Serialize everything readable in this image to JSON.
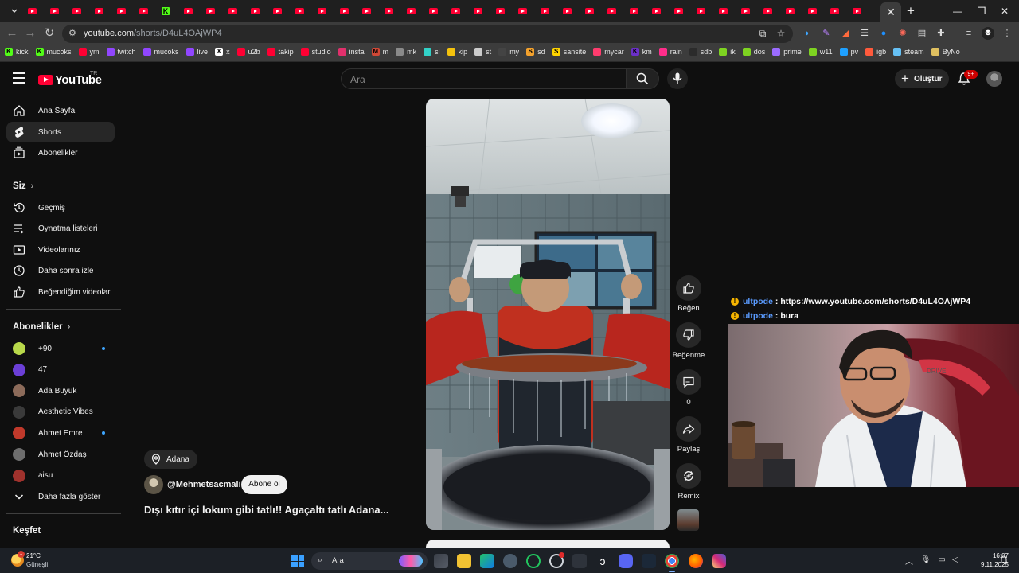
{
  "browser": {
    "tab_count_youtube": 38,
    "url_host": "youtube.com",
    "url_path": "/shorts/D4uL4OAjWP4",
    "bookmarks": [
      {
        "label": "kick",
        "icon": "kick-icon",
        "color": "#53fc18",
        "glyph": "K"
      },
      {
        "label": "mucoks",
        "icon": "kick-icon",
        "color": "#53fc18",
        "glyph": "K"
      },
      {
        "label": "ym",
        "icon": "youtube-music-icon",
        "color": "#ff0033",
        "glyph": ""
      },
      {
        "label": "twitch",
        "icon": "twitch-icon",
        "color": "#9146ff",
        "glyph": ""
      },
      {
        "label": "mucoks",
        "icon": "twitch-icon",
        "color": "#9146ff",
        "glyph": ""
      },
      {
        "label": "live",
        "icon": "twitch-icon",
        "color": "#9146ff",
        "glyph": ""
      },
      {
        "label": "x",
        "icon": "x-icon",
        "color": "#ffffff",
        "glyph": "X"
      },
      {
        "label": "u2b",
        "icon": "youtube-icon",
        "color": "#ff0033",
        "glyph": ""
      },
      {
        "label": "takip",
        "icon": "youtube-icon",
        "color": "#ff0033",
        "glyph": ""
      },
      {
        "label": "studio",
        "icon": "youtube-studio-icon",
        "color": "#ff0033",
        "glyph": ""
      },
      {
        "label": "insta",
        "icon": "instagram-icon",
        "color": "#e1306c",
        "glyph": ""
      },
      {
        "label": "m",
        "icon": "m-icon",
        "color": "#d14836",
        "glyph": "M"
      },
      {
        "label": "mk",
        "icon": "mk-icon",
        "color": "#8a8a8a",
        "glyph": ""
      },
      {
        "label": "sl",
        "icon": "sl-icon",
        "color": "#32d2c8",
        "glyph": ""
      },
      {
        "label": "kip",
        "icon": "kip-icon",
        "color": "#f4c20d",
        "glyph": ""
      },
      {
        "label": "st",
        "icon": "github-icon",
        "color": "#cccccc",
        "glyph": ""
      },
      {
        "label": "my",
        "icon": "my-icon",
        "color": "#444444",
        "glyph": ""
      },
      {
        "label": "sd",
        "icon": "sd-icon",
        "color": "#f4a22d",
        "glyph": "S"
      },
      {
        "label": "sansite",
        "icon": "s-icon",
        "color": "#ffd400",
        "glyph": "S"
      },
      {
        "label": "mycar",
        "icon": "mycar-icon",
        "color": "#ff3c6e",
        "glyph": ""
      },
      {
        "label": "km",
        "icon": "km-icon",
        "color": "#6b2fc9",
        "glyph": "K"
      },
      {
        "label": "rain",
        "icon": "rain-icon",
        "color": "#ff2d8a",
        "glyph": ""
      },
      {
        "label": "sdb",
        "icon": "sdb-icon",
        "color": "#2b2b2b",
        "glyph": ""
      },
      {
        "label": "ik",
        "icon": "power-icon",
        "color": "#7ed321",
        "glyph": ""
      },
      {
        "label": "dos",
        "icon": "power-icon",
        "color": "#7ed321",
        "glyph": ""
      },
      {
        "label": "prime",
        "icon": "prime-icon",
        "color": "#9b6bff",
        "glyph": ""
      },
      {
        "label": "w11",
        "icon": "power-icon",
        "color": "#7ed321",
        "glyph": ""
      },
      {
        "label": "pv",
        "icon": "pv-icon",
        "color": "#1ea0ff",
        "glyph": ""
      },
      {
        "label": "igb",
        "icon": "igb-icon",
        "color": "#ff5a3c",
        "glyph": ""
      },
      {
        "label": "steam",
        "icon": "steam-icon",
        "color": "#66c0f4",
        "glyph": ""
      },
      {
        "label": "ByNo",
        "icon": "byno-icon",
        "color": "#e0c060",
        "glyph": ""
      }
    ]
  },
  "youtube": {
    "logo_text": "YouTube",
    "logo_country": "TR",
    "search_placeholder": "Ara",
    "create_label": "Oluştur",
    "notification_count": "9+",
    "sidebar": {
      "main": [
        {
          "label": "Ana Sayfa",
          "icon": "home-icon",
          "active": false
        },
        {
          "label": "Shorts",
          "icon": "shorts-icon",
          "active": true
        },
        {
          "label": "Abonelikler",
          "icon": "subscriptions-icon",
          "active": false
        }
      ],
      "you_heading": "Siz",
      "you_items": [
        {
          "label": "Geçmiş",
          "icon": "history-icon"
        },
        {
          "label": "Oynatma listeleri",
          "icon": "playlists-icon"
        },
        {
          "label": "Videolarınız",
          "icon": "your-videos-icon"
        },
        {
          "label": "Daha sonra izle",
          "icon": "watch-later-icon"
        },
        {
          "label": "Beğendiğim videolar",
          "icon": "liked-videos-icon"
        }
      ],
      "subs_heading": "Abonelikler",
      "subscriptions": [
        {
          "label": "+90",
          "color": "#b8d84a",
          "new": true
        },
        {
          "label": "47",
          "color": "#6b3fd6",
          "new": false
        },
        {
          "label": "Ada Büyük",
          "color": "#8c6b5a",
          "new": false
        },
        {
          "label": "Aesthetic Vibes",
          "color": "#3a3a3a",
          "new": false
        },
        {
          "label": "Ahmet Emre",
          "color": "#c0392b",
          "new": true
        },
        {
          "label": "Ahmet Özdaş",
          "color": "#6d6d6d",
          "new": false
        },
        {
          "label": "aisu",
          "color": "#a0322d",
          "new": false
        }
      ],
      "show_more": "Daha fazla göster",
      "explore_heading": "Keşfet"
    },
    "short": {
      "location": "Adana",
      "channel": "@Mehmetsacmali",
      "subscribe_label": "Abone ol",
      "title": "Dışı kıtır içi lokum gibi tatlı!! Agaçaltı tatlı Adana..."
    },
    "actions": [
      {
        "label": "Beğen",
        "icon": "like-icon"
      },
      {
        "label": "Beğenme",
        "icon": "dislike-icon"
      },
      {
        "label": "0",
        "icon": "comment-icon"
      },
      {
        "label": "Paylaş",
        "icon": "share-icon"
      },
      {
        "label": "Remix",
        "icon": "remix-icon"
      }
    ]
  },
  "chat": [
    {
      "user": "ultpode",
      "message": ": https://www.youtube.com/shorts/D4uL4OAjWP4"
    },
    {
      "user": "ultpode",
      "message": ": bura"
    }
  ],
  "taskbar": {
    "weather_temp": "21°C",
    "weather_desc": "Güneşli",
    "weather_badge": "1",
    "search_label": "Ara",
    "time": "16:07",
    "date": "9.11.2025"
  }
}
